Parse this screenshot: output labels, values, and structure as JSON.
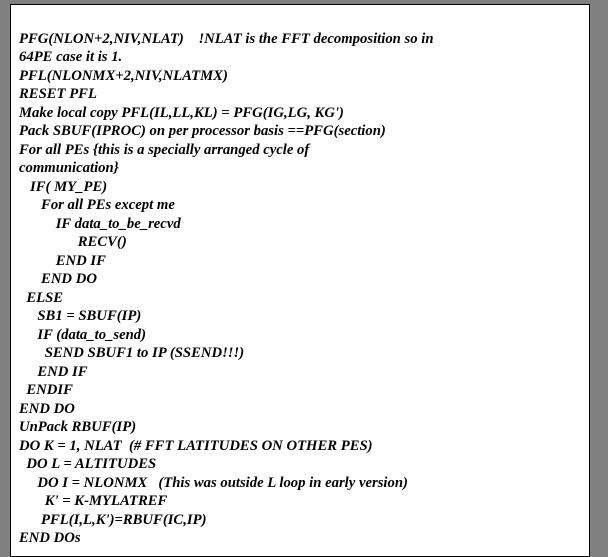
{
  "code": {
    "lines": [
      "PFG(NLON+2,NIV,NLAT)    !NLAT is the FFT decomposition so in",
      "64PE case it is 1.",
      "PFL(NLONMX+2,NIV,NLATMX)",
      "RESET PFL",
      "Make local copy PFL(IL,LL,KL) = PFG(IG,LG, KG')",
      "Pack SBUF(IPROC) on per processor basis ==PFG(section)",
      "For all PEs {this is a specially arranged cycle of",
      "communication}",
      "   IF( MY_PE)",
      "      For all PEs except me",
      "          IF data_to_be_recvd",
      "                RECV()",
      "          END IF",
      "      END DO",
      "  ELSE",
      "     SB1 = SBUF(IP)",
      "     IF (data_to_send)",
      "       SEND SBUF1 to IP (SSEND!!!)",
      "     END IF",
      "  ENDIF",
      "END DO",
      "UnPack RBUF(IP)",
      "DO K = 1, NLAT  (# FFT LATITUDES ON OTHER PES)",
      "  DO L = ALTITUDES",
      "     DO I = NLONMX   (This was outside L loop in early version)",
      "       K' = K-MYLATREF",
      "      PFL(I,L,K')=RBUF(IC,IP)",
      "END DOs"
    ]
  }
}
